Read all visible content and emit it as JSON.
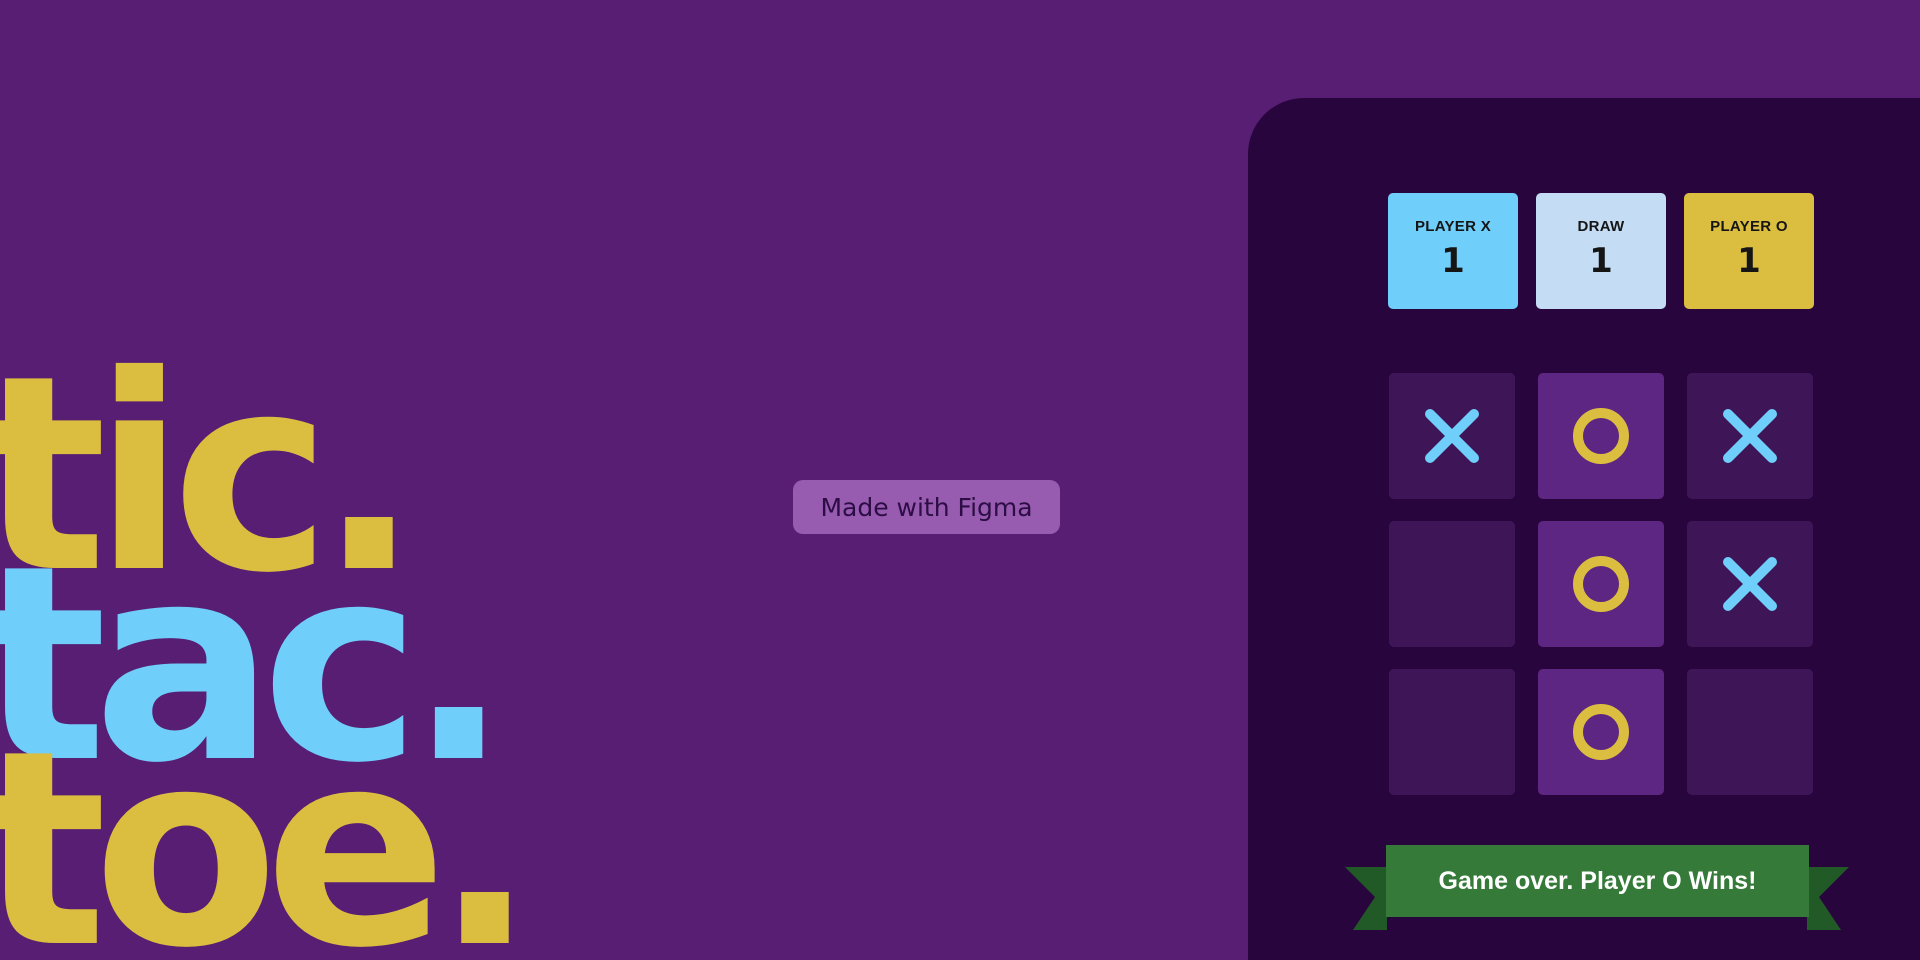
{
  "logo": {
    "line1": "tic.",
    "line2": "tac.",
    "line3": "toe."
  },
  "figma_badge": "Made with Figma",
  "scoreboard": [
    {
      "label": "PLAYER X",
      "value": "1",
      "color": "#6fcefa"
    },
    {
      "label": "DRAW",
      "value": "1",
      "color": "#c5dcf5"
    },
    {
      "label": "PLAYER O",
      "value": "1",
      "color": "#dbbe3f"
    }
  ],
  "board": [
    [
      "X",
      "O",
      "X"
    ],
    [
      "",
      "O",
      "X"
    ],
    [
      "",
      "O",
      ""
    ]
  ],
  "winning_cells": [
    [
      0,
      1
    ],
    [
      1,
      1
    ],
    [
      2,
      1
    ]
  ],
  "result_message": "Game over. Player O Wins!",
  "colors": {
    "background": "#571e73",
    "panel": "#28063d",
    "cell": "#3e1657",
    "cell_highlight": "#5d2682",
    "x_mark": "#6fcefa",
    "o_mark": "#dbbe3f",
    "ribbon": "#367a3a",
    "ribbon_tail": "#225a27"
  },
  "icons": {
    "x": "x-mark-icon",
    "o": "o-mark-icon"
  }
}
